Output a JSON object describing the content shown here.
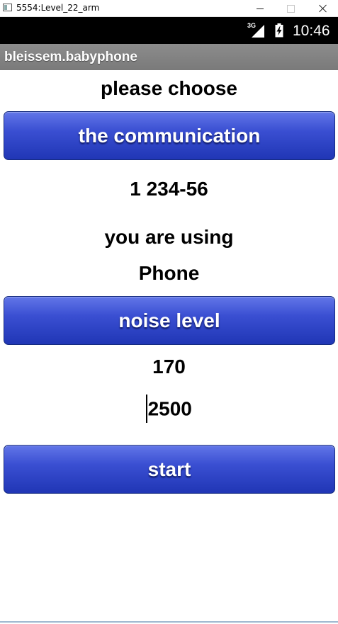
{
  "window": {
    "title": "5554:Level_22_arm",
    "minimize_glyph": "",
    "maximize_glyph": "",
    "close_glyph": ""
  },
  "status_bar": {
    "network_type": "3G",
    "time": "10:46",
    "icons": [
      "signal-icon",
      "battery-charging-icon"
    ]
  },
  "app": {
    "title": "bleissem.babyphone"
  },
  "main": {
    "choose_label": "please choose",
    "communication_button": "the communication",
    "phone_number": "1 234-56",
    "using_label": "you are using",
    "using_value": "Phone",
    "noise_button": "noise level",
    "noise_value": "170",
    "duration_value": "2500",
    "start_button": "start"
  },
  "colors": {
    "button_top": "#6276e8",
    "button_bottom": "#2036b5",
    "titlebar_gray": "#8c8c8c",
    "status_bar": "#000000"
  }
}
